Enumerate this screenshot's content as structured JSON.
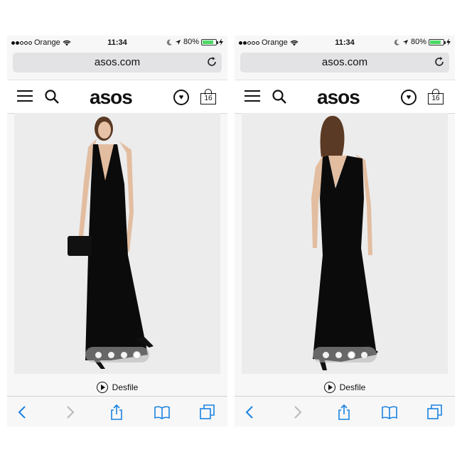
{
  "screens": [
    {
      "status": {
        "carrier": "Orange",
        "time": "11:34",
        "battery": "80%"
      },
      "url": "asos.com",
      "logo": "asos",
      "bag_count": "16",
      "photo": {
        "subject": "back-view-dress",
        "view": "front"
      },
      "carousel": {
        "total": 4,
        "active": 3
      },
      "video_label": "Desfile"
    },
    {
      "status": {
        "carrier": "Orange",
        "time": "11:34",
        "battery": "80%"
      },
      "url": "asos.com",
      "logo": "asos",
      "bag_count": "16",
      "photo": {
        "view": "back"
      },
      "carousel": {
        "total": 4,
        "active": 2
      },
      "video_label": "Desfile"
    }
  ],
  "icons": [
    "wifi-icon",
    "moon-icon",
    "location-arrow-icon",
    "battery-icon",
    "charging-icon",
    "reload-icon",
    "menu-icon",
    "search-icon",
    "heart-icon",
    "bag-icon",
    "play-icon",
    "back-icon",
    "forward-icon",
    "share-icon",
    "bookmarks-icon",
    "tabs-icon"
  ],
  "colors": {
    "accent": "#1a82e2",
    "battery": "#4cd964",
    "disabled": "#b8b8bc"
  }
}
